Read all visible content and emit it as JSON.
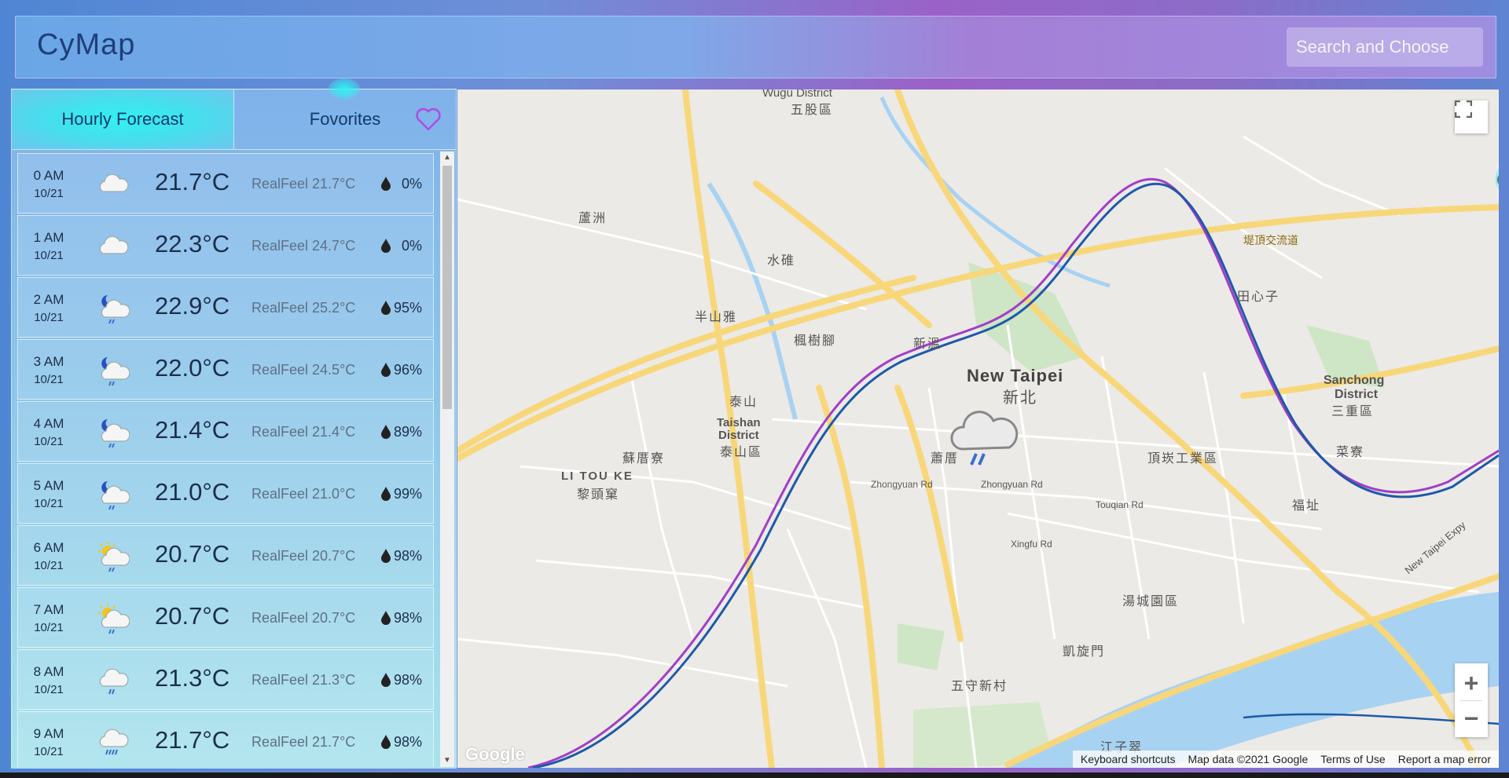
{
  "header": {
    "title": "CyMap",
    "search_placeholder": "Search and Choose"
  },
  "tabs": [
    {
      "label": "Hourly Forecast",
      "active": true
    },
    {
      "label": "Fovorites",
      "active": false
    }
  ],
  "forecast": [
    {
      "time": "0 AM",
      "date": "10/21",
      "icon": "cloudy-icon",
      "temp": "21.7°C",
      "realfeel": "RealFeel 21.7°C",
      "precip": "0%"
    },
    {
      "time": "1 AM",
      "date": "10/21",
      "icon": "cloudy-icon",
      "temp": "22.3°C",
      "realfeel": "RealFeel 24.7°C",
      "precip": "0%"
    },
    {
      "time": "2 AM",
      "date": "10/21",
      "icon": "night-rain-icon",
      "temp": "22.9°C",
      "realfeel": "RealFeel 25.2°C",
      "precip": "95%"
    },
    {
      "time": "3 AM",
      "date": "10/21",
      "icon": "night-rain-icon",
      "temp": "22.0°C",
      "realfeel": "RealFeel 24.5°C",
      "precip": "96%"
    },
    {
      "time": "4 AM",
      "date": "10/21",
      "icon": "night-rain-icon",
      "temp": "21.4°C",
      "realfeel": "RealFeel 21.4°C",
      "precip": "89%"
    },
    {
      "time": "5 AM",
      "date": "10/21",
      "icon": "night-rain-icon",
      "temp": "21.0°C",
      "realfeel": "RealFeel 21.0°C",
      "precip": "99%"
    },
    {
      "time": "6 AM",
      "date": "10/21",
      "icon": "sun-rain-icon",
      "temp": "20.7°C",
      "realfeel": "RealFeel 20.7°C",
      "precip": "98%"
    },
    {
      "time": "7 AM",
      "date": "10/21",
      "icon": "sun-rain-icon",
      "temp": "20.7°C",
      "realfeel": "RealFeel 20.7°C",
      "precip": "98%"
    },
    {
      "time": "8 AM",
      "date": "10/21",
      "icon": "rain-icon",
      "temp": "21.3°C",
      "realfeel": "RealFeel 21.3°C",
      "precip": "98%"
    },
    {
      "time": "9 AM",
      "date": "10/21",
      "icon": "heavy-rain-icon",
      "temp": "21.7°C",
      "realfeel": "RealFeel 21.7°C",
      "precip": "98%"
    }
  ],
  "map": {
    "labels": {
      "wugu_en": "Wugu District",
      "wugu_zh": "五股區",
      "new_taipei_en": "New Taipei",
      "new_taipei_zh": "新北",
      "taishan_en1": "Taishan",
      "taishan_en2": "District",
      "taishan_zh": "泰山區",
      "sanchong_en1": "Sanchong",
      "sanchong_en2": "District",
      "sanchong_zh": "三重區",
      "litouke_en": "LI TOU KE",
      "litouke_zh": "黎頭窠",
      "zhongyuan_rd": "Zhongyuan Rd",
      "xingfu_rd": "Xingfu Rd",
      "touqian_rd": "Touqian Rd",
      "luzhou": "蘆洲",
      "shuiwei": "水碓",
      "banshanya": "半山雅",
      "fengshujiao": "楓樹腳",
      "xinwen": "新溫",
      "taishan_zh2": "泰山",
      "sulicu": "蘇厝寮",
      "xiaocuo": "蕭厝",
      "dingkan": "頂崁工業區",
      "tianxinzi": "田心子",
      "caicuo": "菜寮",
      "fuzhi": "福址",
      "tangcheng": "湯城園區",
      "kaixuanmen": "凱旋門",
      "wushou": "五守新村",
      "jiangzicui": "江子翠",
      "highway": "堤頂交流道",
      "xinzhuang_expy": "New Taipei Expy"
    },
    "zoom_in": "+",
    "zoom_out": "−",
    "footer": {
      "shortcuts": "Keyboard shortcuts",
      "data": "Map data ©2021 Google",
      "terms": "Terms of Use",
      "report": "Report a map error"
    },
    "google_logo": "Google"
  }
}
